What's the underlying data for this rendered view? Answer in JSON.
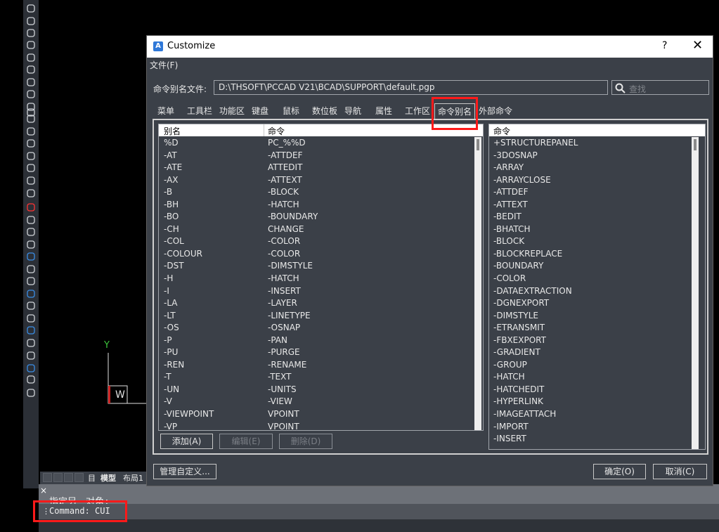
{
  "dialog": {
    "title": "Customize",
    "help_label": "?",
    "close_label": "✕",
    "menu_file": "文件(F)",
    "file_label": "命令别名文件:",
    "file_path": "D:\\THSOFT\\PCCAD V21\\BCAD\\SUPPORT\\default.pgp",
    "search_placeholder": "查找",
    "tabs": [
      {
        "label": "菜单"
      },
      {
        "label": "工具栏"
      },
      {
        "label": "功能区"
      },
      {
        "label": "键盘"
      },
      {
        "label": "鼠标"
      },
      {
        "label": "数位板"
      },
      {
        "label": "导航"
      },
      {
        "label": "属性"
      },
      {
        "label": "工作区"
      },
      {
        "label": "命令别名"
      },
      {
        "label": "外部命令"
      }
    ],
    "alias_list": {
      "header_alias": "别名",
      "header_command": "命令",
      "rows": [
        {
          "alias": "%D",
          "command": "PC_%%D"
        },
        {
          "alias": "-AT",
          "command": "-ATTDEF"
        },
        {
          "alias": "-ATE",
          "command": "ATTEDIT"
        },
        {
          "alias": "-AX",
          "command": "-ATTEXT"
        },
        {
          "alias": "-B",
          "command": "-BLOCK"
        },
        {
          "alias": "-BH",
          "command": "-HATCH"
        },
        {
          "alias": "-BO",
          "command": "-BOUNDARY"
        },
        {
          "alias": "-CH",
          "command": "CHANGE"
        },
        {
          "alias": "-COL",
          "command": "-COLOR"
        },
        {
          "alias": "-COLOUR",
          "command": "-COLOR"
        },
        {
          "alias": "-DST",
          "command": "-DIMSTYLE"
        },
        {
          "alias": "-H",
          "command": "-HATCH"
        },
        {
          "alias": "-I",
          "command": "-INSERT"
        },
        {
          "alias": "-LA",
          "command": "-LAYER"
        },
        {
          "alias": "-LT",
          "command": "-LINETYPE"
        },
        {
          "alias": "-OS",
          "command": "-OSNAP"
        },
        {
          "alias": "-P",
          "command": "-PAN"
        },
        {
          "alias": "-PU",
          "command": "-PURGE"
        },
        {
          "alias": "-REN",
          "command": "-RENAME"
        },
        {
          "alias": "-T",
          "command": "-TEXT"
        },
        {
          "alias": "-UN",
          "command": "-UNITS"
        },
        {
          "alias": "-V",
          "command": "-VIEW"
        },
        {
          "alias": "-VIEWPOINT",
          "command": "VPOINT"
        },
        {
          "alias": "-VP",
          "command": "VPOINT"
        }
      ]
    },
    "command_list": {
      "header": "命令",
      "rows": [
        "+STRUCTUREPANEL",
        "-3DOSNAP",
        "-ARRAY",
        "-ARRAYCLOSE",
        "-ATTDEF",
        "-ATTEXT",
        "-BEDIT",
        "-BHATCH",
        "-BLOCK",
        "-BLOCKREPLACE",
        "-BOUNDARY",
        "-COLOR",
        "-DATAEXTRACTION",
        "-DGNEXPORT",
        "-DIMSTYLE",
        "-ETRANSMIT",
        "-FBXEXPORT",
        "-GRADIENT",
        "-GROUP",
        "-HATCH",
        "-HATCHEDIT",
        "-HYPERLINK",
        "-IMAGEATTACH",
        "-IMPORT",
        "-INSERT"
      ]
    },
    "buttons": {
      "add": "添加(A)",
      "edit": "编辑(E)",
      "delete": "删除(D)",
      "manage": "管理自定义...",
      "ok": "确定(O)",
      "cancel": "取消(C)"
    }
  },
  "canvas": {
    "ucs_y": "Y",
    "ucs_w": "W"
  },
  "layout_tabs": {
    "grid_label": "目",
    "model": "模型",
    "layout1": "布局1"
  },
  "command_area": {
    "close_label": "×",
    "grip_label": "⋮",
    "previous_prompt": "指定另一对角:",
    "current": "Command: CUI"
  },
  "colors": {
    "highlight": "#ff1a1a",
    "icon_blue": "#3a8ee6",
    "ucs_green": "#3cc43c"
  }
}
